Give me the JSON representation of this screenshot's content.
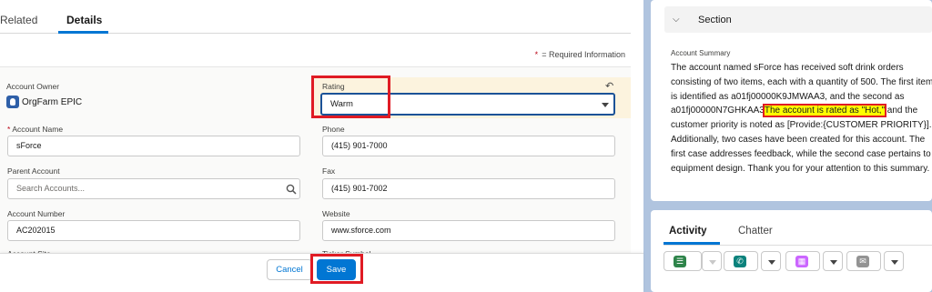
{
  "tabs": {
    "related": "Related",
    "details": "Details"
  },
  "required_info": "= Required Information",
  "required_star": "*",
  "fields": {
    "account_owner": {
      "label": "Account Owner",
      "value": "OrgFarm EPIC"
    },
    "rating": {
      "label": "Rating",
      "value": "Warm"
    },
    "account_name": {
      "label": "Account Name",
      "value": "sForce"
    },
    "phone": {
      "label": "Phone",
      "value": "(415) 901-7000"
    },
    "parent_account": {
      "label": "Parent Account",
      "placeholder": "Search Accounts..."
    },
    "fax": {
      "label": "Fax",
      "value": "(415) 901-7002"
    },
    "account_number": {
      "label": "Account Number",
      "value": "AC202015"
    },
    "website": {
      "label": "Website",
      "value": "www.sforce.com"
    },
    "account_site": {
      "label": "Account Site"
    },
    "ticker_symbol": {
      "label": "Ticker Symbol"
    }
  },
  "buttons": {
    "cancel": "Cancel",
    "save": "Save"
  },
  "section": {
    "title": "Section",
    "summary_label": "Account Summary",
    "summary_before": "The account named sForce has received soft drink orders consisting of two items, each with a quantity of 500. The first item is identified as a01fj00000K9JMWAA3, and the second as a01fj00000N7GHKAA3",
    "summary_highlight": "The account is rated as \"Hot,\"",
    "summary_after": " and the customer priority is noted as [Provide:{CUSTOMER PRIORITY}]. Additionally, two cases have been created for this account. The first case addresses feedback, while the second case pertains to equipment design. Thank you for your attention to this summary."
  },
  "activity": {
    "tab_activity": "Activity",
    "tab_chatter": "Chatter"
  },
  "colors": {
    "brand": "#0176d3",
    "highlight": "#ffff00",
    "annotation": "#e01b24"
  },
  "icons": [
    "undo-icon",
    "search-icon",
    "chevron-down-icon",
    "user-icon",
    "task-icon",
    "call-icon",
    "event-icon",
    "email-icon"
  ]
}
